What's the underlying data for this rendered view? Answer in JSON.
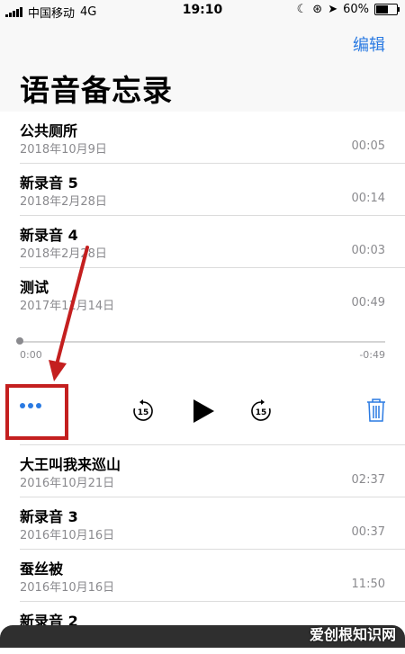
{
  "status_bar": {
    "carrier": "中国移动",
    "network": "4G",
    "time": "19:10",
    "battery": "60%",
    "battery_level": 0.6
  },
  "header": {
    "edit_label": "编辑",
    "title": "语音备忘录"
  },
  "recordings_top": [
    {
      "name": "公共厕所",
      "date": "2018年10月9日",
      "duration": "00:05"
    },
    {
      "name": "新录音 5",
      "date": "2018年2月28日",
      "duration": "00:14"
    },
    {
      "name": "新录音 4",
      "date": "2018年2月28日",
      "duration": "00:03"
    },
    {
      "name": "测试",
      "date": "2017年11月14日",
      "duration": "00:49"
    }
  ],
  "player": {
    "elapsed": "0:00",
    "remaining": "-0:49",
    "progress": 0.0,
    "skip_back_label": "15",
    "skip_forward_label": "15"
  },
  "recordings_bottom": [
    {
      "name": "大王叫我来巡山",
      "date": "2016年10月21日",
      "duration": "02:37"
    },
    {
      "name": "新录音 3",
      "date": "2016年10月16日",
      "duration": "00:37"
    },
    {
      "name": "蚕丝被",
      "date": "2016年10月16日",
      "duration": "11:50"
    },
    {
      "name": "新录音 2",
      "date": "",
      "duration": ""
    }
  ],
  "watermark": "爱创根知识网",
  "colors": {
    "accent": "#2a7ae2",
    "annotation": "#c41f1f"
  }
}
